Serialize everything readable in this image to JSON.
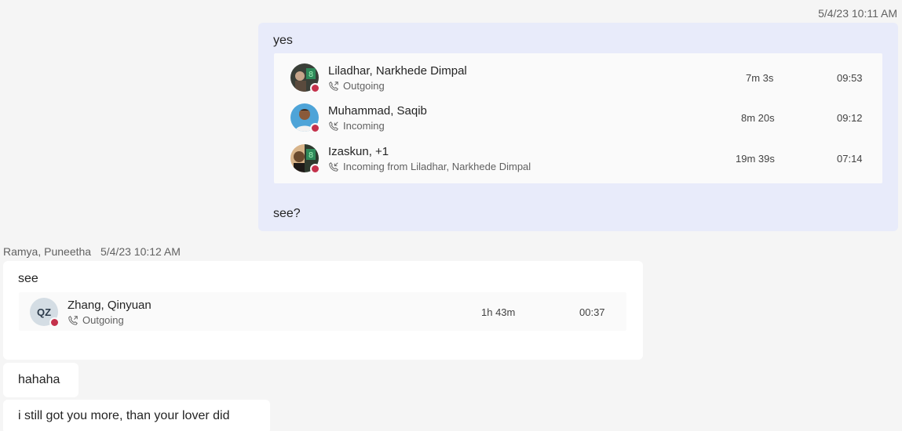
{
  "my_message": {
    "timestamp": "5/4/23 10:11 AM",
    "text_before": "yes",
    "text_after": "see?",
    "calls": [
      {
        "name": "Liladhar, Narkhede Dimpal",
        "direction": "Outgoing",
        "direction_icon": "outgoing-call-icon",
        "duration": "7m 3s",
        "time": "09:53",
        "avatar": "avatar-liladhar"
      },
      {
        "name": "Muhammad, Saqib",
        "direction": "Incoming",
        "direction_icon": "incoming-call-icon",
        "duration": "8m 20s",
        "time": "09:12",
        "avatar": "avatar-saqib"
      },
      {
        "name": "Izaskun, +1",
        "direction": "Incoming from Liladhar, Narkhede Dimpal",
        "direction_icon": "incoming-call-icon",
        "duration": "19m 39s",
        "time": "07:14",
        "avatar": "avatar-izaskun"
      }
    ]
  },
  "other_message": {
    "sender": "Ramya, Puneetha",
    "timestamp": "5/4/23 10:12 AM",
    "text": "see",
    "call": {
      "initials": "QZ",
      "name": "Zhang, Qinyuan",
      "direction": "Outgoing",
      "direction_icon": "outgoing-call-icon",
      "duration": "1h 43m",
      "time": "00:37"
    }
  },
  "followups": [
    "hahaha",
    "i still got you more, than your lover did"
  ],
  "colors": {
    "my_bubble": "#e8ebfa",
    "other_bubble": "#ffffff",
    "status_busy": "#c4314b",
    "background": "#f5f5f5"
  }
}
